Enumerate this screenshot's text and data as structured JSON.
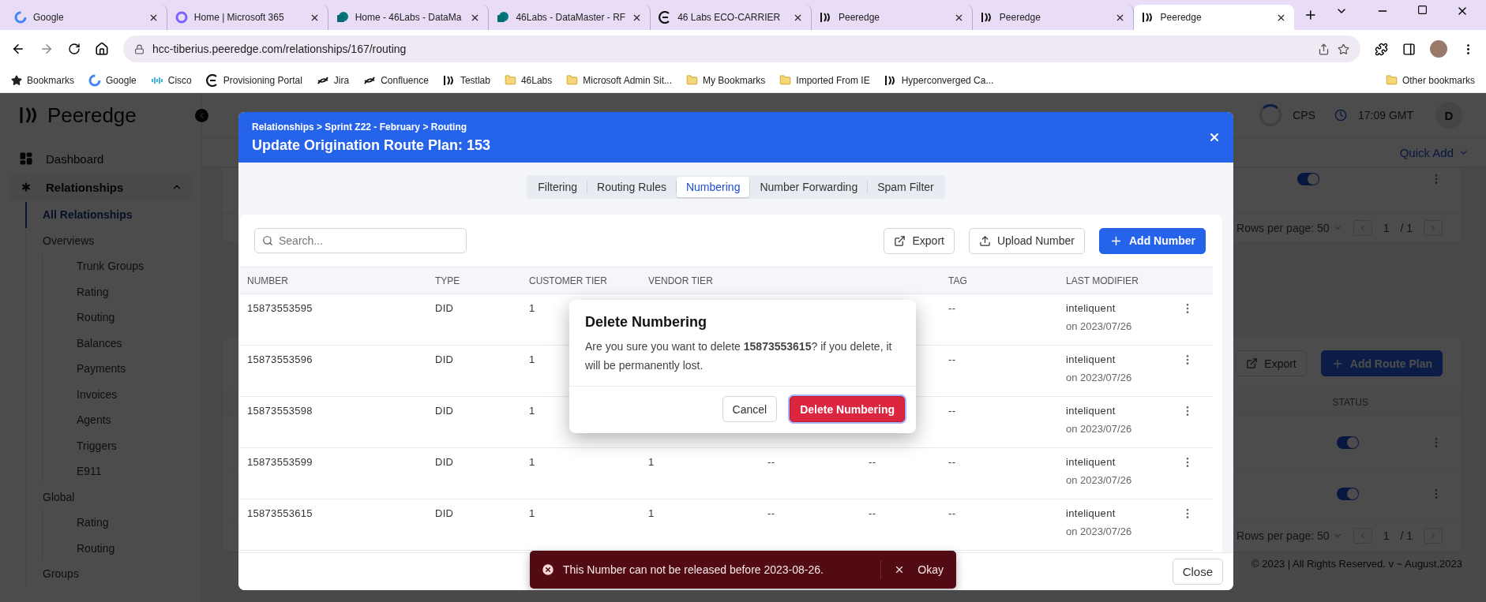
{
  "browser": {
    "tabs": [
      {
        "title": "Google",
        "kind": "google",
        "selected": false
      },
      {
        "title": "Home | Microsoft 365",
        "kind": "ring",
        "selected": false
      },
      {
        "title": "Home - 46Labs - DataMa",
        "kind": "sharepoint",
        "selected": false
      },
      {
        "title": "46Labs - DataMaster - RF",
        "kind": "sharepoint",
        "selected": false
      },
      {
        "title": "46 Labs ECO-CARRIER",
        "kind": "eco",
        "selected": false
      },
      {
        "title": "Peeredge",
        "kind": "peeredge",
        "selected": false
      },
      {
        "title": "Peeredge",
        "kind": "peeredge",
        "selected": false
      },
      {
        "title": "Peeredge",
        "kind": "peeredge",
        "selected": true
      }
    ],
    "url": "hcc-tiberius.peeredge.com/relationships/167/routing",
    "bookmarks": [
      {
        "label": "Bookmarks",
        "kind": "star"
      },
      {
        "label": "Google",
        "kind": "google"
      },
      {
        "label": "Cisco",
        "kind": "cisco"
      },
      {
        "label": "Provisioning Portal",
        "kind": "eco"
      },
      {
        "label": "Jira",
        "kind": "loop"
      },
      {
        "label": "Confluence",
        "kind": "loop"
      },
      {
        "label": "Testlab",
        "kind": "peeredge"
      },
      {
        "label": "46Labs",
        "kind": "folder"
      },
      {
        "label": "Microsoft Admin Sit...",
        "kind": "folder"
      },
      {
        "label": "My Bookmarks",
        "kind": "folder"
      },
      {
        "label": "Imported From IE",
        "kind": "folder"
      },
      {
        "label": "Hyperconverged Ca...",
        "kind": "peeredge"
      }
    ],
    "other_bookmarks": "Other bookmarks"
  },
  "sidebar": {
    "brand": "Peeredge",
    "items": [
      {
        "label": "Dashboard",
        "kind": "dashboard",
        "selected": false
      },
      {
        "label": "Relationships",
        "kind": "relationships",
        "selected": true,
        "expanded": true,
        "children": [
          {
            "label": "All Relationships",
            "selected": true
          },
          {
            "label": "Overviews",
            "selected": false,
            "children": [
              {
                "label": "Trunk Groups",
                "selected": false
              },
              {
                "label": "Rating",
                "selected": false
              },
              {
                "label": "Routing",
                "selected": false
              },
              {
                "label": "Balances",
                "selected": false
              },
              {
                "label": "Payments",
                "selected": false
              },
              {
                "label": "Invoices",
                "selected": false
              },
              {
                "label": "Agents",
                "selected": false
              },
              {
                "label": "Triggers",
                "selected": false
              },
              {
                "label": "E911",
                "selected": false
              }
            ]
          },
          {
            "label": "Global",
            "selected": false,
            "children": [
              {
                "label": "Rating",
                "selected": false
              },
              {
                "label": "Routing",
                "selected": false
              }
            ]
          },
          {
            "label": "Groups",
            "selected": false
          }
        ]
      }
    ]
  },
  "header": {
    "cps": "CPS",
    "time": "17:09 GMT",
    "avatar": "D",
    "quick_add": "Quick Add"
  },
  "top_card": {
    "rows": [
      {
        "on": true
      }
    ],
    "rows_per_page": "Rows per page: 50",
    "page": "1",
    "total": "/ 1"
  },
  "route_plans": {
    "export": "Export",
    "add": "Add Route Plan",
    "status_header": "STATUS",
    "rows": [
      {
        "on": true
      },
      {
        "on": true
      }
    ],
    "rows_per_page": "Rows per page: 50",
    "page": "1",
    "total": "/ 1"
  },
  "footer": "© 2023 | All Rights Reserved. v ~ August,2023",
  "modal": {
    "breadcrumb": "Relationships > Sprint Z22 - February > Routing",
    "title": "Update Origination Route Plan: 153",
    "tabs": [
      {
        "label": "Filtering",
        "selected": false
      },
      {
        "label": "Routing Rules",
        "selected": false
      },
      {
        "label": "Numbering",
        "selected": true
      },
      {
        "label": "Number Forwarding",
        "selected": false
      },
      {
        "label": "Spam Filter",
        "selected": false
      }
    ],
    "search_placeholder": "Search...",
    "export": "Export",
    "upload": "Upload Number",
    "add": "Add Number",
    "columns": [
      "NUMBER",
      "TYPE",
      "CUSTOMER TIER",
      "VENDOR TIER",
      "TAG",
      "LAST MODIFIER"
    ],
    "rows": [
      {
        "number": "15873553595",
        "type": "DID",
        "customer_tier": "1",
        "tag": "--",
        "modifier": "inteliquent",
        "modified_on": "on 2023/07/26"
      },
      {
        "number": "15873553596",
        "type": "DID",
        "customer_tier": "1",
        "tag": "--",
        "modifier": "inteliquent",
        "modified_on": "on 2023/07/26"
      },
      {
        "number": "15873553598",
        "type": "DID",
        "customer_tier": "1",
        "tag": "--",
        "modifier": "inteliquent",
        "modified_on": "on 2023/07/26"
      },
      {
        "number": "15873553599",
        "type": "DID",
        "customer_tier": "1",
        "vendor_tier": "1",
        "column_5": "--",
        "column_6": "--",
        "tag": "--",
        "modifier": "inteliquent",
        "modified_on": "on 2023/07/26"
      },
      {
        "number": "15873553615",
        "type": "DID",
        "customer_tier": "1",
        "vendor_tier": "1",
        "column_5": "--",
        "column_6": "--",
        "tag": "--",
        "modifier": "inteliquent",
        "modified_on": "on 2023/07/26"
      }
    ],
    "close": "Close"
  },
  "confirm": {
    "title": "Delete Numbering",
    "message": "Are you sure you want to delete **15873553615**? if you delete, it will be permanently lost.",
    "cancel": "Cancel",
    "confirm": "Delete Numbering"
  },
  "toast": {
    "message": "This Number can not be released before 2023-08-26.",
    "action": "Okay"
  }
}
